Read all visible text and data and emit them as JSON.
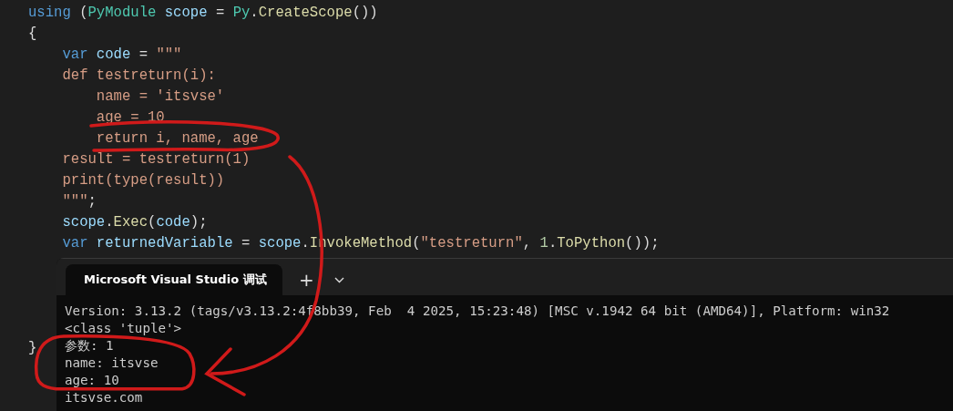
{
  "editor": {
    "lines": [
      {
        "tokens": [
          {
            "text": "using",
            "kind": "keyword"
          },
          {
            "text": " (",
            "kind": "plain"
          },
          {
            "text": "PyModule",
            "kind": "type"
          },
          {
            "text": " scope",
            "kind": "ident"
          },
          {
            "text": " = ",
            "kind": "plain"
          },
          {
            "text": "Py",
            "kind": "type"
          },
          {
            "text": ".",
            "kind": "plain"
          },
          {
            "text": "CreateScope",
            "kind": "method"
          },
          {
            "text": "())",
            "kind": "plain"
          }
        ]
      },
      {
        "tokens": [
          {
            "text": "{",
            "kind": "plain"
          }
        ]
      },
      {
        "tokens": [
          {
            "text": "    var",
            "kind": "keyword"
          },
          {
            "text": " code",
            "kind": "ident"
          },
          {
            "text": " = ",
            "kind": "plain"
          },
          {
            "text": "\"\"\"",
            "kind": "string"
          }
        ]
      },
      {
        "tokens": [
          {
            "text": "    def testreturn(i):",
            "kind": "string"
          }
        ]
      },
      {
        "tokens": [
          {
            "text": "        name = 'itsvse'",
            "kind": "string"
          }
        ]
      },
      {
        "tokens": [
          {
            "text": "        age = 10",
            "kind": "string"
          }
        ]
      },
      {
        "tokens": [
          {
            "text": "        return i, name, age",
            "kind": "string"
          }
        ]
      },
      {
        "tokens": [
          {
            "text": "    result = testreturn(1)",
            "kind": "string"
          }
        ]
      },
      {
        "tokens": [
          {
            "text": "    print(type(result))",
            "kind": "string"
          }
        ]
      },
      {
        "tokens": [
          {
            "text": "    \"\"\"",
            "kind": "string"
          },
          {
            "text": ";",
            "kind": "plain"
          }
        ]
      },
      {
        "tokens": [
          {
            "text": "    scope",
            "kind": "ident"
          },
          {
            "text": ".",
            "kind": "plain"
          },
          {
            "text": "Exec",
            "kind": "method"
          },
          {
            "text": "(",
            "kind": "plain"
          },
          {
            "text": "code",
            "kind": "ident"
          },
          {
            "text": ");",
            "kind": "plain"
          }
        ]
      },
      {
        "tokens": [
          {
            "text": "    var",
            "kind": "keyword"
          },
          {
            "text": " returnedVariable",
            "kind": "ident"
          },
          {
            "text": " = ",
            "kind": "plain"
          },
          {
            "text": "scope",
            "kind": "ident"
          },
          {
            "text": ".",
            "kind": "plain"
          },
          {
            "text": "InvokeMethod",
            "kind": "method"
          },
          {
            "text": "(",
            "kind": "plain"
          },
          {
            "text": "\"testreturn\"",
            "kind": "string"
          },
          {
            "text": ", ",
            "kind": "plain"
          },
          {
            "text": "1",
            "kind": "number"
          },
          {
            "text": ".",
            "kind": "plain"
          },
          {
            "text": "ToPython",
            "kind": "method"
          },
          {
            "text": "());",
            "kind": "plain"
          }
        ]
      }
    ],
    "lines_below": [
      {
        "tokens": [
          {
            "text": "}",
            "kind": "plain"
          }
        ]
      }
    ]
  },
  "terminal": {
    "tab": {
      "title": "Microsoft Visual Studio 调试",
      "selected": true
    },
    "new_tab": "+",
    "output": [
      "Version: 3.13.2 (tags/v3.13.2:4f8bb39, Feb  4 2025, 15:23:48) [MSC v.1942 64 bit (AMD64)], Platform: win32",
      "<class 'tuple'>",
      "参数: 1",
      "name: itsvse",
      "age: 10",
      "itsvse.com"
    ]
  }
}
